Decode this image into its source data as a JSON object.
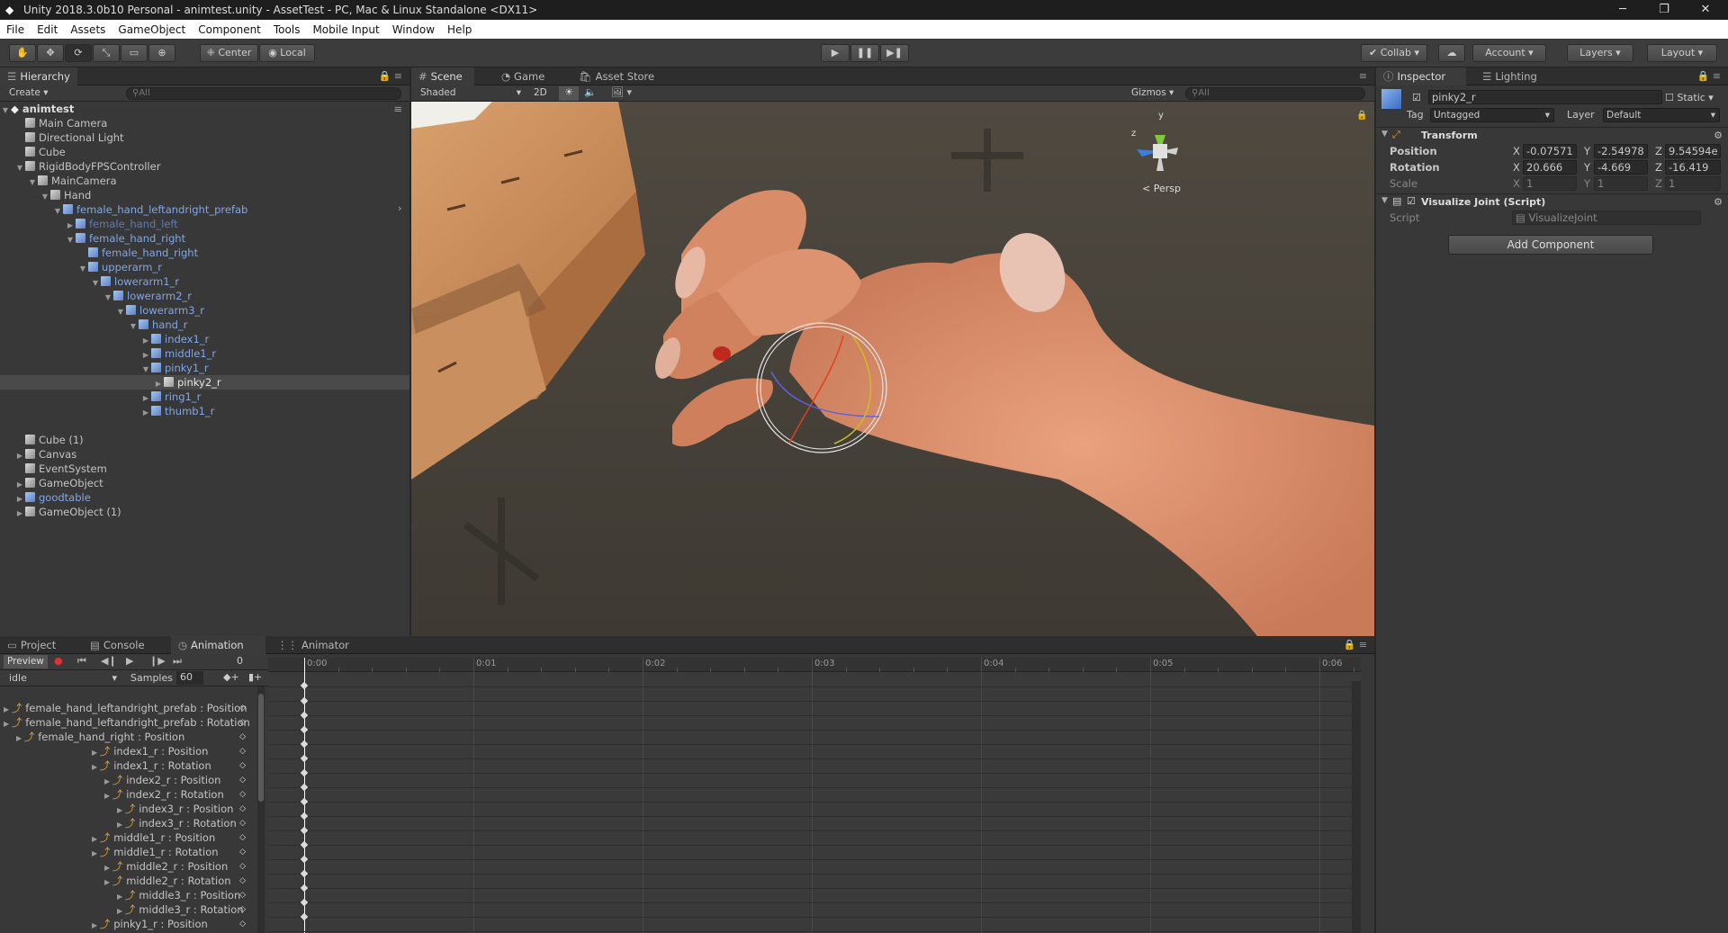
{
  "title": "Unity 2018.3.0b10 Personal - animtest.unity - AssetTest - PC, Mac & Linux Standalone <DX11>",
  "window_controls": {
    "minimize": "─",
    "maximize": "❐",
    "close": "✕"
  },
  "menu": [
    "File",
    "Edit",
    "Assets",
    "GameObject",
    "Component",
    "Tools",
    "Mobile Input",
    "Window",
    "Help"
  ],
  "toolbar": {
    "pivot": "Center",
    "space": "Local",
    "collab": "Collab",
    "account": "Account",
    "layers": "Layers",
    "layout": "Layout"
  },
  "hierarchy": {
    "tab": "Hierarchy",
    "create": "Create",
    "search_placeholder": "All",
    "scene_name": "animtest",
    "rows": [
      {
        "label": "Main Camera",
        "indent": 1,
        "arrow": "",
        "kind": "go"
      },
      {
        "label": "Directional Light",
        "indent": 1,
        "arrow": "",
        "kind": "go"
      },
      {
        "label": "Cube",
        "indent": 1,
        "arrow": "",
        "kind": "go"
      },
      {
        "label": "RigidBodyFPSController",
        "indent": 1,
        "arrow": "▼",
        "kind": "go"
      },
      {
        "label": "MainCamera",
        "indent": 2,
        "arrow": "▼",
        "kind": "go"
      },
      {
        "label": "Hand",
        "indent": 3,
        "arrow": "▼",
        "kind": "go"
      },
      {
        "label": "female_hand_leftandright_prefab",
        "indent": 4,
        "arrow": "▼",
        "kind": "pf"
      },
      {
        "label": "female_hand_left",
        "indent": 5,
        "arrow": "▶",
        "kind": "pfd"
      },
      {
        "label": "female_hand_right",
        "indent": 5,
        "arrow": "▼",
        "kind": "pf"
      },
      {
        "label": "female_hand_right",
        "indent": 6,
        "arrow": "",
        "kind": "pf"
      },
      {
        "label": "upperarm_r",
        "indent": 6,
        "arrow": "▼",
        "kind": "pf"
      },
      {
        "label": "lowerarm1_r",
        "indent": 7,
        "arrow": "▼",
        "kind": "pf"
      },
      {
        "label": "lowerarm2_r",
        "indent": 8,
        "arrow": "▼",
        "kind": "pf"
      },
      {
        "label": "lowerarm3_r",
        "indent": 9,
        "arrow": "▼",
        "kind": "pf"
      },
      {
        "label": "hand_r",
        "indent": 10,
        "arrow": "▼",
        "kind": "pf"
      },
      {
        "label": "index1_r",
        "indent": 11,
        "arrow": "▶",
        "kind": "pf"
      },
      {
        "label": "middle1_r",
        "indent": 11,
        "arrow": "▶",
        "kind": "pf"
      },
      {
        "label": "pinky1_r",
        "indent": 11,
        "arrow": "▼",
        "kind": "pf"
      },
      {
        "label": "pinky2_r",
        "indent": 12,
        "arrow": "▶",
        "kind": "sel"
      },
      {
        "label": "ring1_r",
        "indent": 11,
        "arrow": "▶",
        "kind": "pf"
      },
      {
        "label": "thumb1_r",
        "indent": 11,
        "arrow": "▶",
        "kind": "pf"
      },
      {
        "label": "",
        "indent": 0,
        "arrow": "",
        "kind": "blank"
      },
      {
        "label": "Cube (1)",
        "indent": 1,
        "arrow": "",
        "kind": "go"
      },
      {
        "label": "Canvas",
        "indent": 1,
        "arrow": "▶",
        "kind": "go"
      },
      {
        "label": "EventSystem",
        "indent": 1,
        "arrow": "",
        "kind": "go"
      },
      {
        "label": "GameObject",
        "indent": 1,
        "arrow": "▶",
        "kind": "go"
      },
      {
        "label": "goodtable",
        "indent": 1,
        "arrow": "▶",
        "kind": "pf"
      },
      {
        "label": "GameObject (1)",
        "indent": 1,
        "arrow": "▶",
        "kind": "go"
      }
    ]
  },
  "scene": {
    "tabs": [
      "Scene",
      "Game",
      "Asset Store"
    ],
    "shading": "Shaded",
    "mode_2d": "2D",
    "gizmos": "Gizmos",
    "search_placeholder": "All",
    "persp": "Persp",
    "axis_y": "y",
    "axis_z": "z"
  },
  "inspector": {
    "tabs": [
      "Inspector",
      "Lighting"
    ],
    "object_name": "pinky2_r",
    "static": "Static",
    "tag_label": "Tag",
    "tag": "Untagged",
    "layer_label": "Layer",
    "layer": "Default",
    "transform": {
      "header": "Transform",
      "position_label": "Position",
      "rotation_label": "Rotation",
      "scale_label": "Scale",
      "position": {
        "x": "-0.07571",
        "y": "-2.54978",
        "z": "9.54594e"
      },
      "rotation": {
        "x": "20.666",
        "y": "-4.669",
        "z": "-16.419"
      },
      "scale": {
        "x": "1",
        "y": "1",
        "z": "1"
      }
    },
    "script_component": {
      "header": "Visualize Joint (Script)",
      "script_label": "Script",
      "script": "VisualizeJoint"
    },
    "add_component": "Add Component"
  },
  "bottom": {
    "tabs": [
      "Project",
      "Console",
      "Animation",
      "Animator"
    ],
    "preview": "Preview",
    "frame": "0",
    "clip": "idle",
    "samples_label": "Samples",
    "samples": "60",
    "time_labels": [
      "0:00",
      "0:01",
      "0:02",
      "0:03",
      "0:04",
      "0:05",
      "0:06"
    ],
    "properties": [
      {
        "label": "female_hand_leftandright_prefab : Position",
        "indent": 0
      },
      {
        "label": "female_hand_leftandright_prefab : Rotation",
        "indent": 0
      },
      {
        "label": "female_hand_right : Position",
        "indent": 1
      },
      {
        "label": "index1_r : Position",
        "indent": 7
      },
      {
        "label": "index1_r : Rotation",
        "indent": 7
      },
      {
        "label": "index2_r : Position",
        "indent": 8
      },
      {
        "label": "index2_r : Rotation",
        "indent": 8
      },
      {
        "label": "index3_r : Position",
        "indent": 9
      },
      {
        "label": "index3_r : Rotation",
        "indent": 9
      },
      {
        "label": "middle1_r : Position",
        "indent": 7
      },
      {
        "label": "middle1_r : Rotation",
        "indent": 7
      },
      {
        "label": "middle2_r : Position",
        "indent": 8
      },
      {
        "label": "middle2_r : Rotation",
        "indent": 8
      },
      {
        "label": "middle3_r : Position",
        "indent": 9
      },
      {
        "label": "middle3_r : Rotation",
        "indent": 9
      },
      {
        "label": "pinky1_r : Position",
        "indent": 7
      }
    ]
  }
}
